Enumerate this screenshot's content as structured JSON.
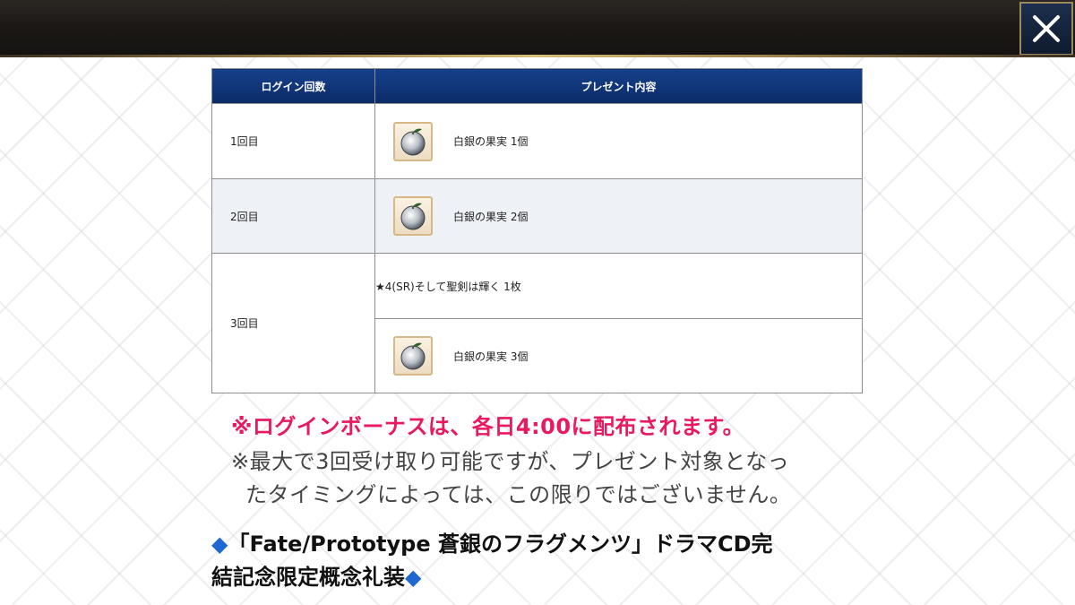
{
  "table": {
    "headers": [
      "ログイン回数",
      "プレゼント内容"
    ],
    "rows": [
      {
        "count": "1回目",
        "prizes": [
          "白銀の果実 1個"
        ]
      },
      {
        "count": "2回目",
        "prizes": [
          "白銀の果実 2個"
        ]
      },
      {
        "count": "3回目",
        "prizes": [
          "★4(SR)そして聖剣は輝く 1枚",
          "白銀の果実 3個"
        ]
      }
    ]
  },
  "notes": {
    "distribution": "※ログインボーナスは、各日4:00に配布されます。",
    "limit_line1": "※最大で3回受け取り可能ですが、プレゼント対象となっ",
    "limit_line2": "たタイミングによっては、この限りではございません。"
  },
  "section_heading": {
    "line1": "「Fate/Prototype 蒼銀のフラグメンツ」ドラマCD完",
    "line2": "結記念限定概念礼装",
    "marker": "◆"
  },
  "icons": {
    "close": "close-icon",
    "item": "silver-fruit-icon",
    "marker": "diamond-icon"
  },
  "colors": {
    "header_bg": "#0b2b66",
    "alert_text": "#e8195f",
    "marker": "#1f67d1",
    "close_border": "#9c8a5c"
  }
}
